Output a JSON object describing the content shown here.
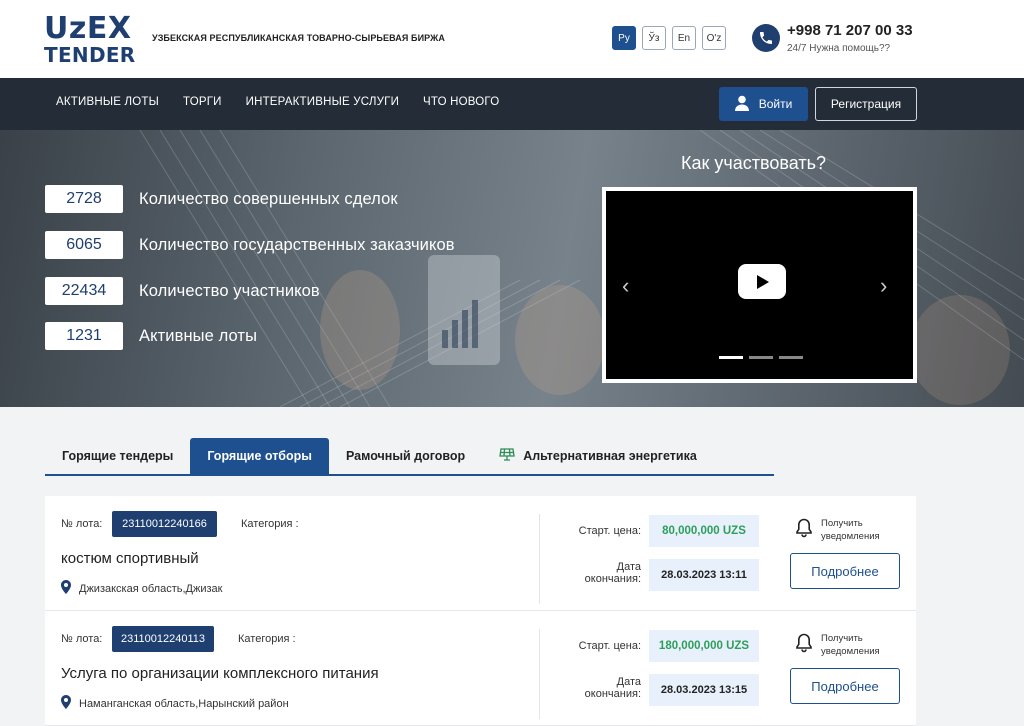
{
  "header": {
    "logo_line1": "UzEX",
    "logo_line2": "TENDER",
    "org_name": "УЗБЕКСКАЯ РЕСПУБЛИКАНСКАЯ ТОВАРНО-СЫРЬЕВАЯ БИРЖА",
    "languages": [
      "Ру",
      "Ўз",
      "En",
      "O'z"
    ],
    "active_language": "Ру",
    "phone": "+998 71 207 00 33",
    "phone_note": "24/7 Нужна помощь??"
  },
  "nav": {
    "items": [
      "АКТИВНЫЕ ЛОТЫ",
      "ТОРГИ",
      "ИНТЕРАКТИВНЫЕ УСЛУГИ",
      "ЧТО НОВОГО"
    ],
    "login_label": "Войти",
    "register_label": "Регистрация"
  },
  "hero": {
    "stats": [
      {
        "value": "2728",
        "label": "Количество совершенных сделок"
      },
      {
        "value": "6065",
        "label": "Количество государственных заказчиков"
      },
      {
        "value": "22434",
        "label": "Количество участников"
      },
      {
        "value": "1231",
        "label": "Активные лоты"
      }
    ],
    "how_title": "Как участвовать?",
    "slider_count": 3,
    "slider_active": 1
  },
  "tabs": {
    "items": [
      "Горящие тендеры",
      "Горящие отборы",
      "Рамочный договор",
      "Альтернативная энергетика"
    ],
    "active": "Горящие отборы"
  },
  "lots_labels": {
    "lot_no": "№ лота:",
    "category": "Категория :",
    "start_price": "Старт. цена:",
    "end_date_line1": "Дата",
    "end_date_line2": "окончания:",
    "notify_line1": "Получить",
    "notify_line2": "уведомления",
    "details": "Подробнее"
  },
  "lots": [
    {
      "number": "23110012240166",
      "title": "костюм спортивный",
      "location": "Джизакская область,Джизак",
      "price": "80,000,000 UZS",
      "end_date": "28.03.2023 13:11"
    },
    {
      "number": "23110012240113",
      "title": "Услуга по организации комплексного питания",
      "location": "Наманганская область,Нарынский район",
      "price": "180,000,000 UZS",
      "end_date": "28.03.2023 13:15"
    }
  ],
  "colors": {
    "brand": "#1e3f6f",
    "accent": "#1e4f8f",
    "navbar": "#242d37",
    "price_green": "#2e9e5b"
  }
}
